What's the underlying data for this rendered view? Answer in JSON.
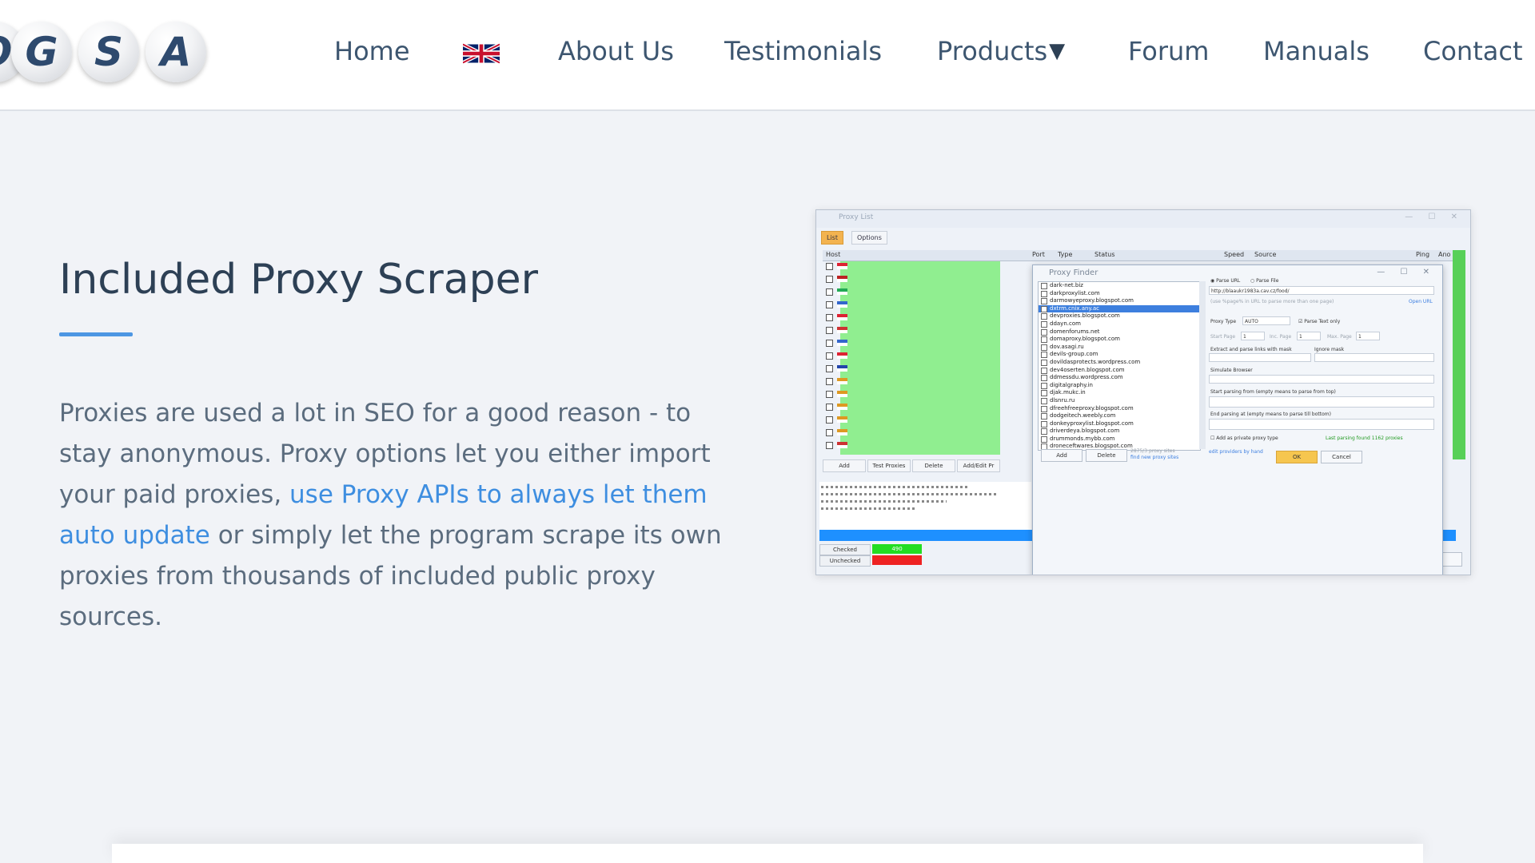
{
  "logo": {
    "letters": [
      "O",
      "G",
      "S",
      "A"
    ]
  },
  "nav": {
    "items": [
      {
        "label": "Home"
      },
      {
        "label": "About Us"
      },
      {
        "label": "Testimonials"
      },
      {
        "label": "Products"
      },
      {
        "label": "Forum"
      },
      {
        "label": "Manuals"
      },
      {
        "label": "Contact"
      }
    ],
    "products_caret": "▼",
    "language_flag": "uk-flag-icon"
  },
  "feature": {
    "title": "Included Proxy Scraper",
    "accent_color": "#4d96e3",
    "description_before": "Proxies are used a lot in SEO for a good reason - to stay anonymous. Proxy options let you either import your paid proxies, ",
    "description_link": "use Proxy APIs to always let them auto update",
    "description_after": " or simply let the program scrape its own proxies from thousands of included public proxy sources."
  },
  "screenshot": {
    "window_title": "Proxy List",
    "tabs": [
      "List",
      "Options"
    ],
    "columns": [
      "Host",
      "Port",
      "Type",
      "Status",
      "Speed",
      "Source",
      "Ping",
      "Ano"
    ],
    "buttons": [
      "Add",
      "Test Proxies",
      "Delete",
      "Add/Edit Pr"
    ],
    "stats": [
      {
        "label": "Checked",
        "value": "490",
        "color": "#22dd22"
      },
      {
        "label": "Unchecked",
        "value": "",
        "color": "#ee2222"
      }
    ],
    "ok": "OK",
    "finder": {
      "title": "Proxy Finder",
      "sources": [
        "dark-net.biz",
        "darkproxylist.com",
        "darmowyeproxy.blogspot.com",
        "dxtrm.cnix.any.ac",
        "devproxies.blogspot.com",
        "ddayn.com",
        "domenforums.net",
        "domaproxy.blogspot.com",
        "dov.asagi.ru",
        "devils-group.com",
        "dovildasprotects.wordpress.com",
        "dev4oserten.blogspot.com",
        "ddmessdu.wordpress.com",
        "digitalgraphy.in",
        "djak.mukc.in",
        "dlsnru.ru",
        "dfreehfreeproxy.blogspot.com",
        "dodgeitech.weebly.com",
        "donkeyproxylist.blogspot.com",
        "driverdeya.blogspot.com",
        "drummonds.mybb.com",
        "droneceftwares.blogspot.com",
        "dubblust.rulubb.com"
      ],
      "parse_url": "Parse URL",
      "parse_file": "Parse File",
      "url_value": "http://blaaukr1983a.cav.cz/food/",
      "url_hint": "(use %page% in URL to parse more than one page)",
      "open_url": "Open URL",
      "proxy_type_label": "Proxy Type",
      "proxy_type_value": "AUTO",
      "parse_text_only": "Parse Text only",
      "start_page": "Start Page",
      "start_page_value": "1",
      "inc_page": "Inc. Page",
      "inc_page_value": "1",
      "max_page": "Max. Page",
      "max_page_value": "1",
      "extract_links": "Extract and parse links with mask",
      "ignore_mask": "Ignore mask",
      "simulate_browser": "Simulate Browser",
      "start_parsing": "Start parsing from (empty means to parse from top)",
      "end_parsing": "End parsing at (empty means to parse till bottom)",
      "private_proxy": "Add as private proxy type",
      "last_found": "Last parsing found 1162 proxies",
      "add": "Add",
      "delete": "Delete",
      "proxy_sites_count": "2875/3 proxy sites",
      "find_new": "find new proxy sites",
      "edit_providers": "edit providers by hand",
      "ok": "OK",
      "cancel": "Cancel"
    }
  }
}
